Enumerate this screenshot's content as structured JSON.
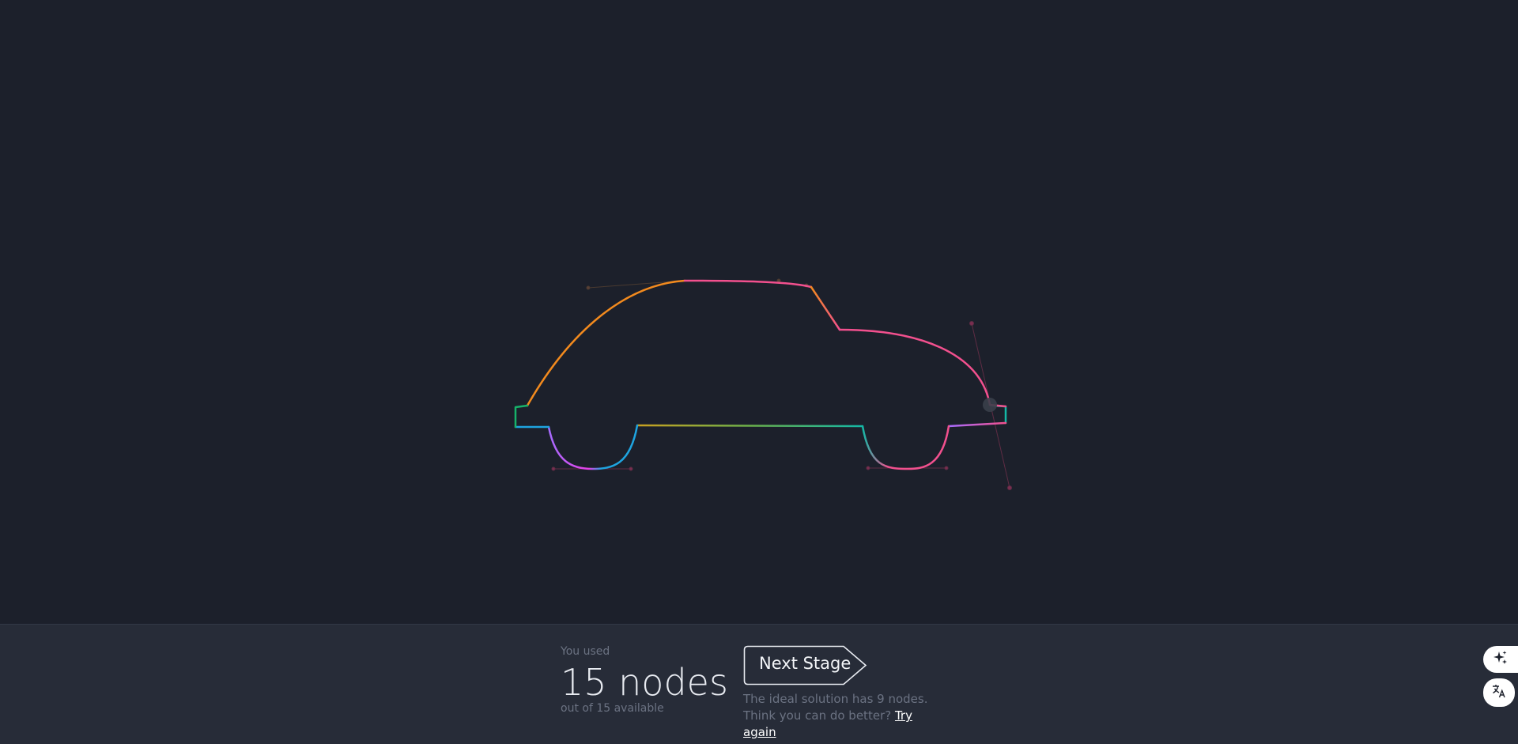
{
  "stats": {
    "used_label": "You used",
    "nodes_text": "15 nodes",
    "available_text": "out of 15 available"
  },
  "next_button": {
    "label": "Next Stage"
  },
  "hint": {
    "text": "The ideal solution has 9 nodes. Think you can do better?",
    "link": "Try again"
  },
  "icons": {
    "sparkle": "sparkle-icon",
    "translate": "translate-icon"
  },
  "colors": {
    "background": "#1c202b",
    "bar": "#272c38",
    "orange": "#f28a1e",
    "pink": "#f2508e",
    "magenta": "#e640e6",
    "blue": "#1ea4e0",
    "green": "#17b26a",
    "teal": "#14b8a6",
    "purple": "#a66cff",
    "olive": "#a8a028"
  }
}
